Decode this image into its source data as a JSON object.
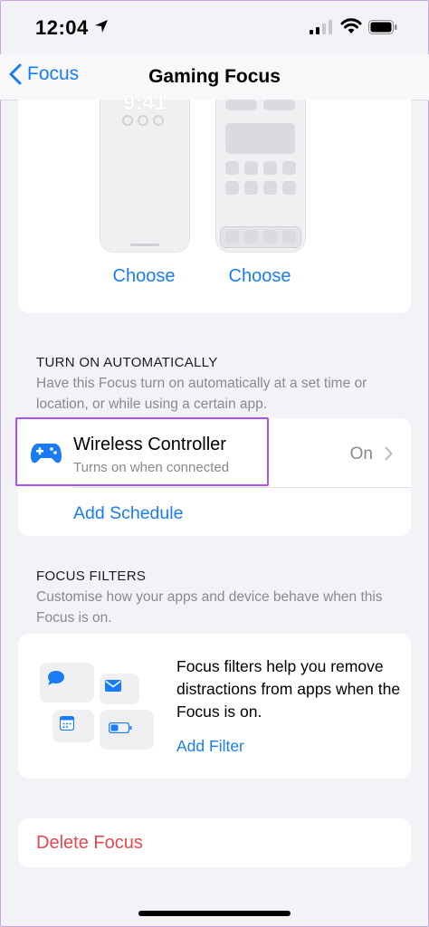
{
  "status_bar": {
    "time": "12:04",
    "icons": [
      "location-arrow-icon",
      "cellular-signal-icon",
      "wifi-icon",
      "battery-icon"
    ]
  },
  "nav": {
    "back_label": "Focus",
    "title": "Gaming Focus"
  },
  "customize_screens": {
    "lock_screen_time": "9:41",
    "lock_choose_label": "Choose",
    "home_choose_label": "Choose"
  },
  "turn_on_automatically": {
    "header": "TURN ON AUTOMATICALLY",
    "description": "Have this Focus turn on automatically at a set time or location, or while using a certain app.",
    "automation": {
      "icon": "game-controller-icon",
      "title": "Wireless Controller",
      "subtitle": "Turns on when connected",
      "value": "On"
    },
    "add_schedule_label": "Add Schedule"
  },
  "focus_filters": {
    "header": "FOCUS FILTERS",
    "description": "Customise how your apps and device behave when this Focus is on.",
    "info_text": "Focus filters help you remove distractions from apps when the Focus is on.",
    "add_filter_label": "Add Filter",
    "tile_icons": [
      "message-bubble-icon",
      "mail-icon",
      "calendar-icon",
      "battery-low-icon"
    ]
  },
  "delete": {
    "label": "Delete Focus"
  },
  "colors": {
    "accent": "#1a7cf5",
    "destructive": "#e5484d",
    "highlight": "#a855f7",
    "background": "#f2f2f7"
  }
}
